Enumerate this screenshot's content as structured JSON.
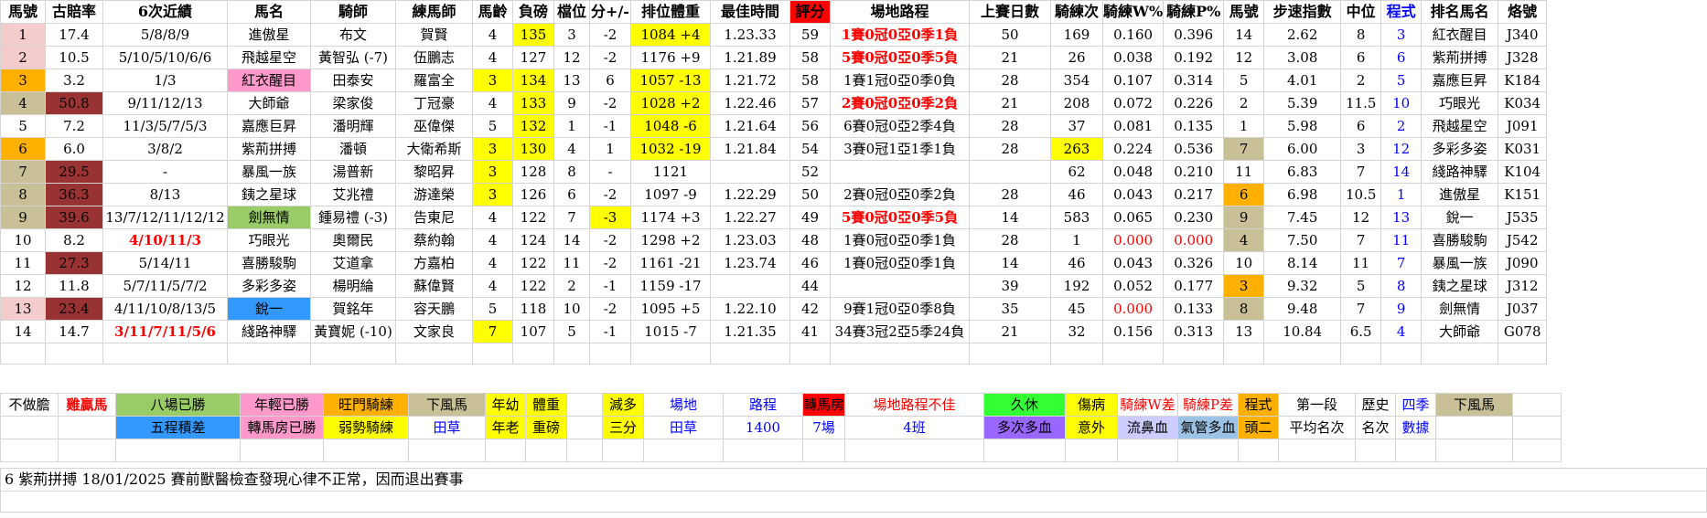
{
  "headers": [
    "馬號",
    "古賠率",
    "6次近績",
    "馬名",
    "騎師",
    "練馬師",
    "馬齡",
    "負磅",
    "檔位",
    "分+/-",
    "排位體重",
    "最佳時間",
    "評分",
    "場地路程",
    "上賽日數",
    "騎練次",
    "騎練W%",
    "騎練P%",
    "馬號",
    "步速指數",
    "中位",
    "程式",
    "排名馬名",
    "烙號"
  ],
  "rows": [
    [
      "1",
      "17.4",
      "5/8/8/9",
      "進傲星",
      "布文",
      "賀賢",
      "4",
      "135",
      "3",
      "-2",
      "1084 +4",
      "1.23.33",
      "59",
      "1賽0冠0亞0季1負",
      "50",
      "169",
      "0.160",
      "0.396",
      "14",
      "2.62",
      "8",
      "3",
      "紅衣醒目",
      "J340"
    ],
    [
      "2",
      "10.5",
      "5/10/5/10/6/6",
      "飛越星空",
      "黃智弘 (-7)",
      "伍鵬志",
      "4",
      "127",
      "12",
      "-2",
      "1176 +9",
      "1.21.89",
      "58",
      "5賽0冠0亞0季5負",
      "21",
      "26",
      "0.038",
      "0.192",
      "12",
      "3.08",
      "6",
      "6",
      "紫荊拼搏",
      "J328"
    ],
    [
      "3",
      "3.2",
      "1/3",
      "紅衣醒目",
      "田泰安",
      "羅富全",
      "3",
      "134",
      "13",
      "6",
      "1057 -13",
      "1.21.72",
      "58",
      "1賽1冠0亞0季0負",
      "28",
      "354",
      "0.107",
      "0.314",
      "5",
      "4.01",
      "2",
      "5",
      "嘉應巨昇",
      "K184"
    ],
    [
      "4",
      "50.8",
      "9/11/12/13",
      "大師爺",
      "梁家俊",
      "丁冠豪",
      "4",
      "133",
      "9",
      "-2",
      "1028 +2",
      "1.22.46",
      "57",
      "2賽0冠0亞0季2負",
      "21",
      "208",
      "0.072",
      "0.226",
      "2",
      "5.39",
      "11.5",
      "10",
      "巧眼光",
      "K034"
    ],
    [
      "5",
      "7.2",
      "11/3/5/7/5/3",
      "嘉應巨昇",
      "潘明輝",
      "巫偉傑",
      "5",
      "132",
      "1",
      "-1",
      "1048 -6",
      "1.21.64",
      "56",
      "6賽0冠0亞2季4負",
      "28",
      "37",
      "0.081",
      "0.135",
      "1",
      "5.98",
      "6",
      "2",
      "飛越星空",
      "J091"
    ],
    [
      "6",
      "6.0",
      "3/8/2",
      "紫荊拼搏",
      "潘頓",
      "大衛希斯",
      "3",
      "130",
      "4",
      "1",
      "1032 -19",
      "1.21.84",
      "54",
      "3賽0冠1亞1季1負",
      "28",
      "263",
      "0.224",
      "0.536",
      "7",
      "6.00",
      "3",
      "12",
      "多彩多姿",
      "K031"
    ],
    [
      "7",
      "29.5",
      "-",
      "暴風一族",
      "湯普新",
      "黎昭昇",
      "3",
      "128",
      "8",
      "-",
      "1121",
      "",
      "52",
      "",
      "",
      "62",
      "0.048",
      "0.210",
      "11",
      "6.83",
      "7",
      "14",
      "綫路神驛",
      "K104"
    ],
    [
      "8",
      "36.3",
      "8/13",
      "銕之星球",
      "艾兆禮",
      "游達榮",
      "3",
      "126",
      "6",
      "-2",
      "1097 -9",
      "1.22.29",
      "50",
      "2賽0冠0亞0季2負",
      "28",
      "46",
      "0.043",
      "0.217",
      "6",
      "6.98",
      "10.5",
      "1",
      "進傲星",
      "K151"
    ],
    [
      "9",
      "39.6",
      "13/7/12/11/12/12",
      "劍無情",
      "鍾易禮 (-3)",
      "告東尼",
      "4",
      "122",
      "7",
      "-3",
      "1174 +3",
      "1.22.27",
      "49",
      "5賽0冠0亞0季5負",
      "14",
      "583",
      "0.065",
      "0.230",
      "9",
      "7.45",
      "12",
      "13",
      "銳一",
      "J535"
    ],
    [
      "10",
      "8.2",
      "4/10/11/3",
      "巧眼光",
      "奧爾民",
      "蔡約翰",
      "4",
      "124",
      "14",
      "-2",
      "1298 +2",
      "1.23.03",
      "48",
      "1賽0冠0亞0季1負",
      "28",
      "1",
      "0.000",
      "0.000",
      "4",
      "7.50",
      "7",
      "11",
      "喜勝駿駒",
      "J542"
    ],
    [
      "11",
      "27.3",
      "5/14/11",
      "喜勝駿駒",
      "艾道拿",
      "方嘉柏",
      "4",
      "122",
      "11",
      "-2",
      "1161 -21",
      "1.23.74",
      "46",
      "1賽0冠0亞0季1負",
      "14",
      "46",
      "0.043",
      "0.326",
      "10",
      "8.14",
      "11",
      "7",
      "暴風一族",
      "J090"
    ],
    [
      "12",
      "11.8",
      "5/7/11/5/7/2",
      "多彩多姿",
      "楊明綸",
      "蘇偉賢",
      "4",
      "122",
      "2",
      "-1",
      "1159 -17",
      "",
      "44",
      "",
      "39",
      "192",
      "0.052",
      "0.177",
      "3",
      "9.32",
      "5",
      "8",
      "銕之星球",
      "J312"
    ],
    [
      "13",
      "23.4",
      "4/11/10/8/13/5",
      "銳一",
      "賀銘年",
      "容天鵬",
      "5",
      "118",
      "10",
      "-2",
      "1095 +5",
      "1.22.10",
      "42",
      "9賽1冠0亞0季8負",
      "35",
      "45",
      "0.000",
      "0.133",
      "8",
      "9.48",
      "7",
      "9",
      "劍無情",
      "J037"
    ],
    [
      "14",
      "14.7",
      "3/11/7/11/5/6",
      "綫路神驛",
      "黃寶妮 (-10)",
      "文家良",
      "7",
      "107",
      "5",
      "-1",
      "1015 -7",
      "1.21.35",
      "41",
      "34賽3冠2亞5季24負",
      "21",
      "32",
      "0.156",
      "0.313",
      "13",
      "10.84",
      "6.5",
      "4",
      "大師爺",
      "G078"
    ]
  ],
  "legend_row1": [
    "不做膽",
    "雞贏馬",
    "八場已勝",
    "年輕已勝",
    "旺門騎練",
    "下風馬",
    "年幼",
    "體重",
    "減多",
    "場地",
    "路程",
    "轉馬房",
    "場地路程不佳",
    "久休",
    "傷病",
    "騎練W差",
    "騎練P差",
    "程式",
    "第一段",
    "歷史",
    "四季",
    "下風馬"
  ],
  "legend_row2": [
    "五程積差",
    "轉馬房已勝",
    "弱勢騎練",
    "田草",
    "年老",
    "重磅",
    "三分",
    "田草",
    "1400",
    "7場",
    "4班",
    "多次多血",
    "意外",
    "流鼻血",
    "氣管多血",
    "頭二",
    "平均名次",
    "名次",
    "數據"
  ],
  "note": "6 紫荊拼搏  18/01/2025  賽前獸醫檢查發現心律不正常，因而退出賽事",
  "colors": {
    "yellow": "#ffff00",
    "maroon": "#993333",
    "pink": "#f4cccc",
    "orange": "#ffb000",
    "khaki": "#c9c098",
    "red": "#ff0000",
    "blue": "#0000ff"
  }
}
